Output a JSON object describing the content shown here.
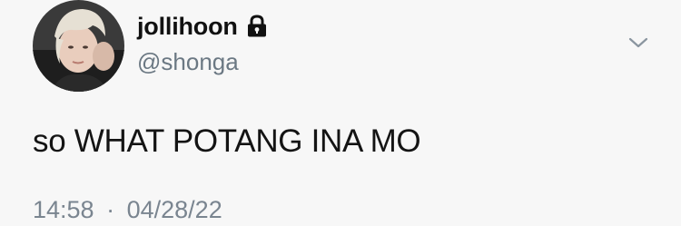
{
  "user": {
    "display_name": "jollihoon",
    "handle": "@shonga",
    "avatar_icon": "avatar",
    "protected_icon": "lock-icon"
  },
  "tweet": {
    "text": "so WHAT POTANG INA MO",
    "time": "14:58",
    "separator": "·",
    "date": "04/28/22"
  },
  "menu": {
    "icon": "chevron-down-icon"
  },
  "colors": {
    "background": "#f7f7f7",
    "text": "#111111",
    "secondary_text": "#6b7883"
  }
}
